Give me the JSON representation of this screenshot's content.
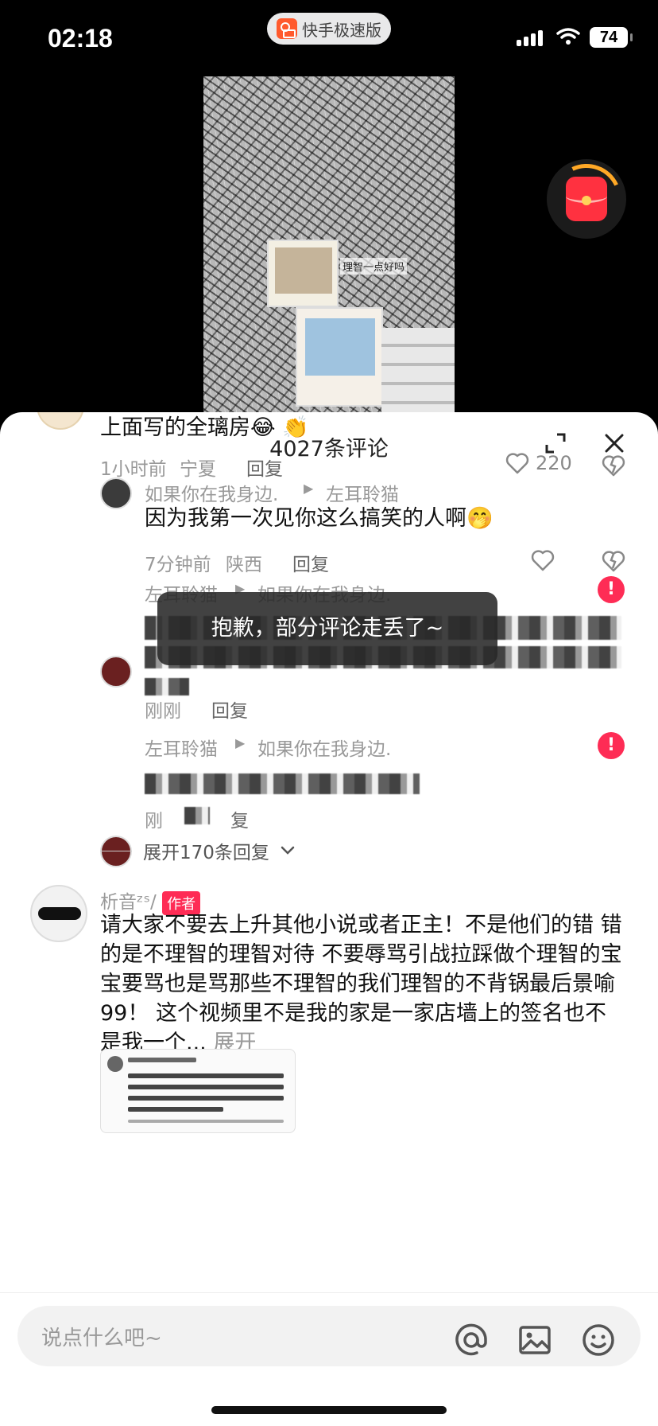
{
  "status": {
    "time": "02:18",
    "app_name": "快手极速版",
    "battery": "74"
  },
  "video": {
    "caption": "理智一点好吗"
  },
  "comments_panel": {
    "title": "4027条评论",
    "first_comment": {
      "text": "上面写的全璃房😂 👏",
      "time": "1小时前",
      "location": "宁夏",
      "reply_label": "回复",
      "likes": "220"
    },
    "replies": [
      {
        "from": "如果你在我身边.",
        "to": "左耳聆猫",
        "text": "因为我第一次见你这么搞笑的人啊🤭",
        "time": "7分钟前",
        "location": "陕西",
        "reply_label": "回复"
      },
      {
        "from": "左耳聆猫",
        "to": "如果你在我身边.",
        "time": "刚刚",
        "reply_label": "回复"
      },
      {
        "from": "左耳聆猫",
        "to": "如果你在我身边.",
        "time": "刚",
        "reply_label": "复"
      }
    ],
    "toast": "抱歉，部分评论走丢了~",
    "expand_replies": "展开170条回复",
    "author_comment": {
      "username": "析音ᶻˢ/",
      "tag": "作者",
      "text": "请大家不要去上升其他小说或者正主！不是他们的错 错的是不理智的理智对待 不要辱骂引战拉踩做个理智的宝宝要骂也是骂那些不理智的我们理智的不背锅最后景喻99！ 这个视频里不是我的家是一家店墙上的签名也不是我一个...",
      "more": "展开"
    }
  },
  "input_bar": {
    "placeholder": "说点什么吧~"
  }
}
